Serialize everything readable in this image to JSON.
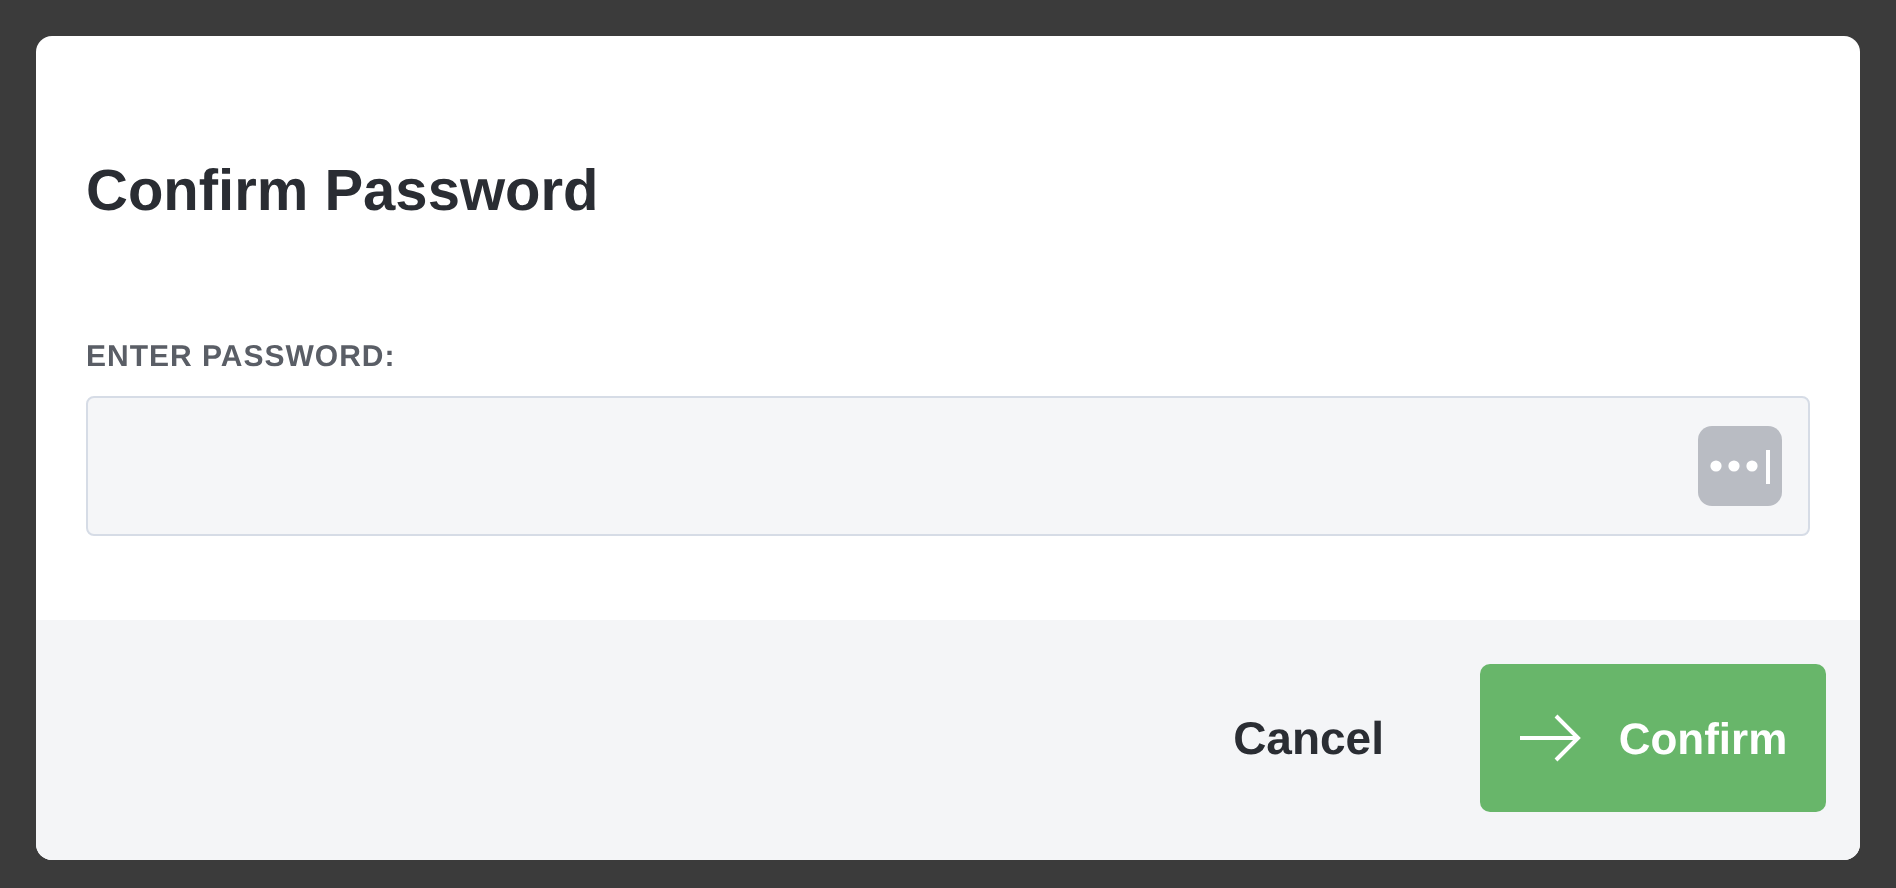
{
  "dialog": {
    "title": "Confirm Password",
    "field": {
      "label": "ENTER PASSWORD:"
    },
    "buttons": [
      {
        "kind": "plain",
        "label": "Cancel"
      },
      {
        "kind": "primary",
        "label": "Confirm"
      }
    ]
  }
}
